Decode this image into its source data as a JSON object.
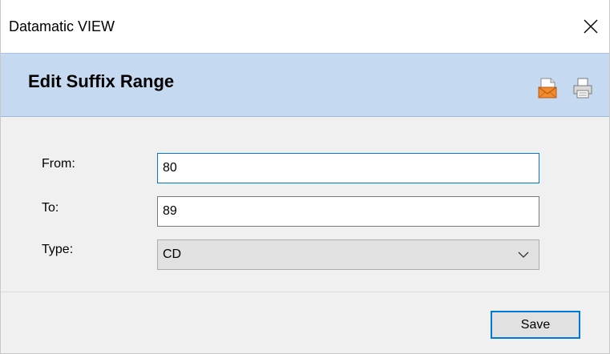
{
  "window": {
    "title": "Datamatic VIEW",
    "close_icon": "close-icon"
  },
  "header": {
    "title": "Edit Suffix Range",
    "icons": [
      "email-icon",
      "print-icon"
    ]
  },
  "form": {
    "from": {
      "label": "From:",
      "value": "80"
    },
    "to": {
      "label": "To:",
      "value": "89"
    },
    "type": {
      "label": "Type:",
      "selected": "CD"
    }
  },
  "footer": {
    "save_label": "Save"
  },
  "colors": {
    "header_bg": "#c5d9f1",
    "focus_border": "#0078d7",
    "window_bg": "#f0f0f0"
  }
}
